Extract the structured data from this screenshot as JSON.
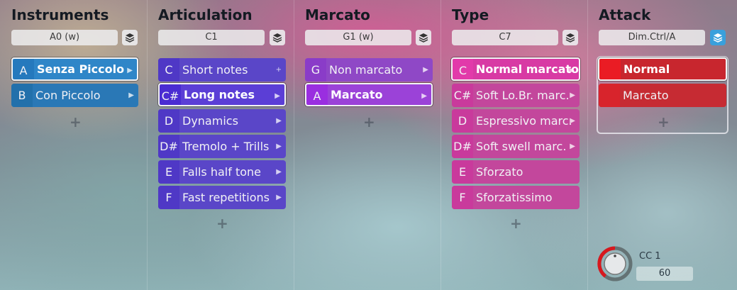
{
  "columns": [
    {
      "title": "Instruments",
      "slot": "A0 (w)",
      "layer_icon": "layers-icon",
      "items": [
        {
          "key": "A",
          "label": "Senza Piccolo",
          "selected": true,
          "arrow": "▶"
        },
        {
          "key": "B",
          "label": "Con Piccolo",
          "selected": false,
          "arrow": "▶"
        }
      ],
      "add": "+"
    },
    {
      "title": "Articulation",
      "slot": "C1",
      "layer_icon": "layers-icon",
      "items": [
        {
          "key": "C",
          "label": "Short notes",
          "selected": false,
          "arrow": "+"
        },
        {
          "key": "C#",
          "label": "Long notes",
          "selected": true,
          "arrow": "▶"
        },
        {
          "key": "D",
          "label": "Dynamics",
          "selected": false,
          "arrow": "▶"
        },
        {
          "key": "D#",
          "label": "Tremolo + Trills",
          "selected": false,
          "arrow": "▶"
        },
        {
          "key": "E",
          "label": "Falls half tone",
          "selected": false,
          "arrow": "▶"
        },
        {
          "key": "F",
          "label": "Fast repetitions",
          "selected": false,
          "arrow": "▶"
        }
      ],
      "add": "+"
    },
    {
      "title": "Marcato",
      "slot": "G1 (w)",
      "layer_icon": "layers-icon",
      "items": [
        {
          "key": "G",
          "label": "Non marcato",
          "selected": false,
          "arrow": "▶"
        },
        {
          "key": "A",
          "label": "Marcato",
          "selected": true,
          "arrow": "▶"
        }
      ],
      "add": "+"
    },
    {
      "title": "Type",
      "slot": "C7",
      "layer_icon": "layers-icon",
      "items": [
        {
          "key": "C",
          "label": "Normal marcato",
          "selected": true,
          "arrow": "▶"
        },
        {
          "key": "C#",
          "label": "Soft Lo.Br. marc.",
          "selected": false,
          "arrow": "▶"
        },
        {
          "key": "D",
          "label": "Espressivo marc.",
          "selected": false,
          "arrow": "▶"
        },
        {
          "key": "D#",
          "label": "Soft swell marc.",
          "selected": false,
          "arrow": "▶"
        },
        {
          "key": "E",
          "label": "Sforzato",
          "selected": false,
          "arrow": ""
        },
        {
          "key": "F",
          "label": "Sforzatissimo",
          "selected": false,
          "arrow": ""
        }
      ],
      "add": "+"
    },
    {
      "title": "Attack",
      "slot": "Dim.Ctrl/A",
      "layer_icon": "layers-icon",
      "items": [
        {
          "key": "",
          "label": "Normal",
          "selected": true,
          "arrow": ""
        },
        {
          "key": "",
          "label": "Marcato",
          "selected": false,
          "arrow": ""
        }
      ],
      "add": "+"
    }
  ],
  "controller": {
    "label": "CC 1",
    "value": "60",
    "knob_icon": "knob-icon"
  },
  "colors": {
    "instruments": "#2f86c8",
    "articulation": "#5b3ed6",
    "marcato": "#9b42d8",
    "type": "#d83aa4",
    "attack": "#d72c34",
    "layer_active": "#3aa0dc"
  }
}
